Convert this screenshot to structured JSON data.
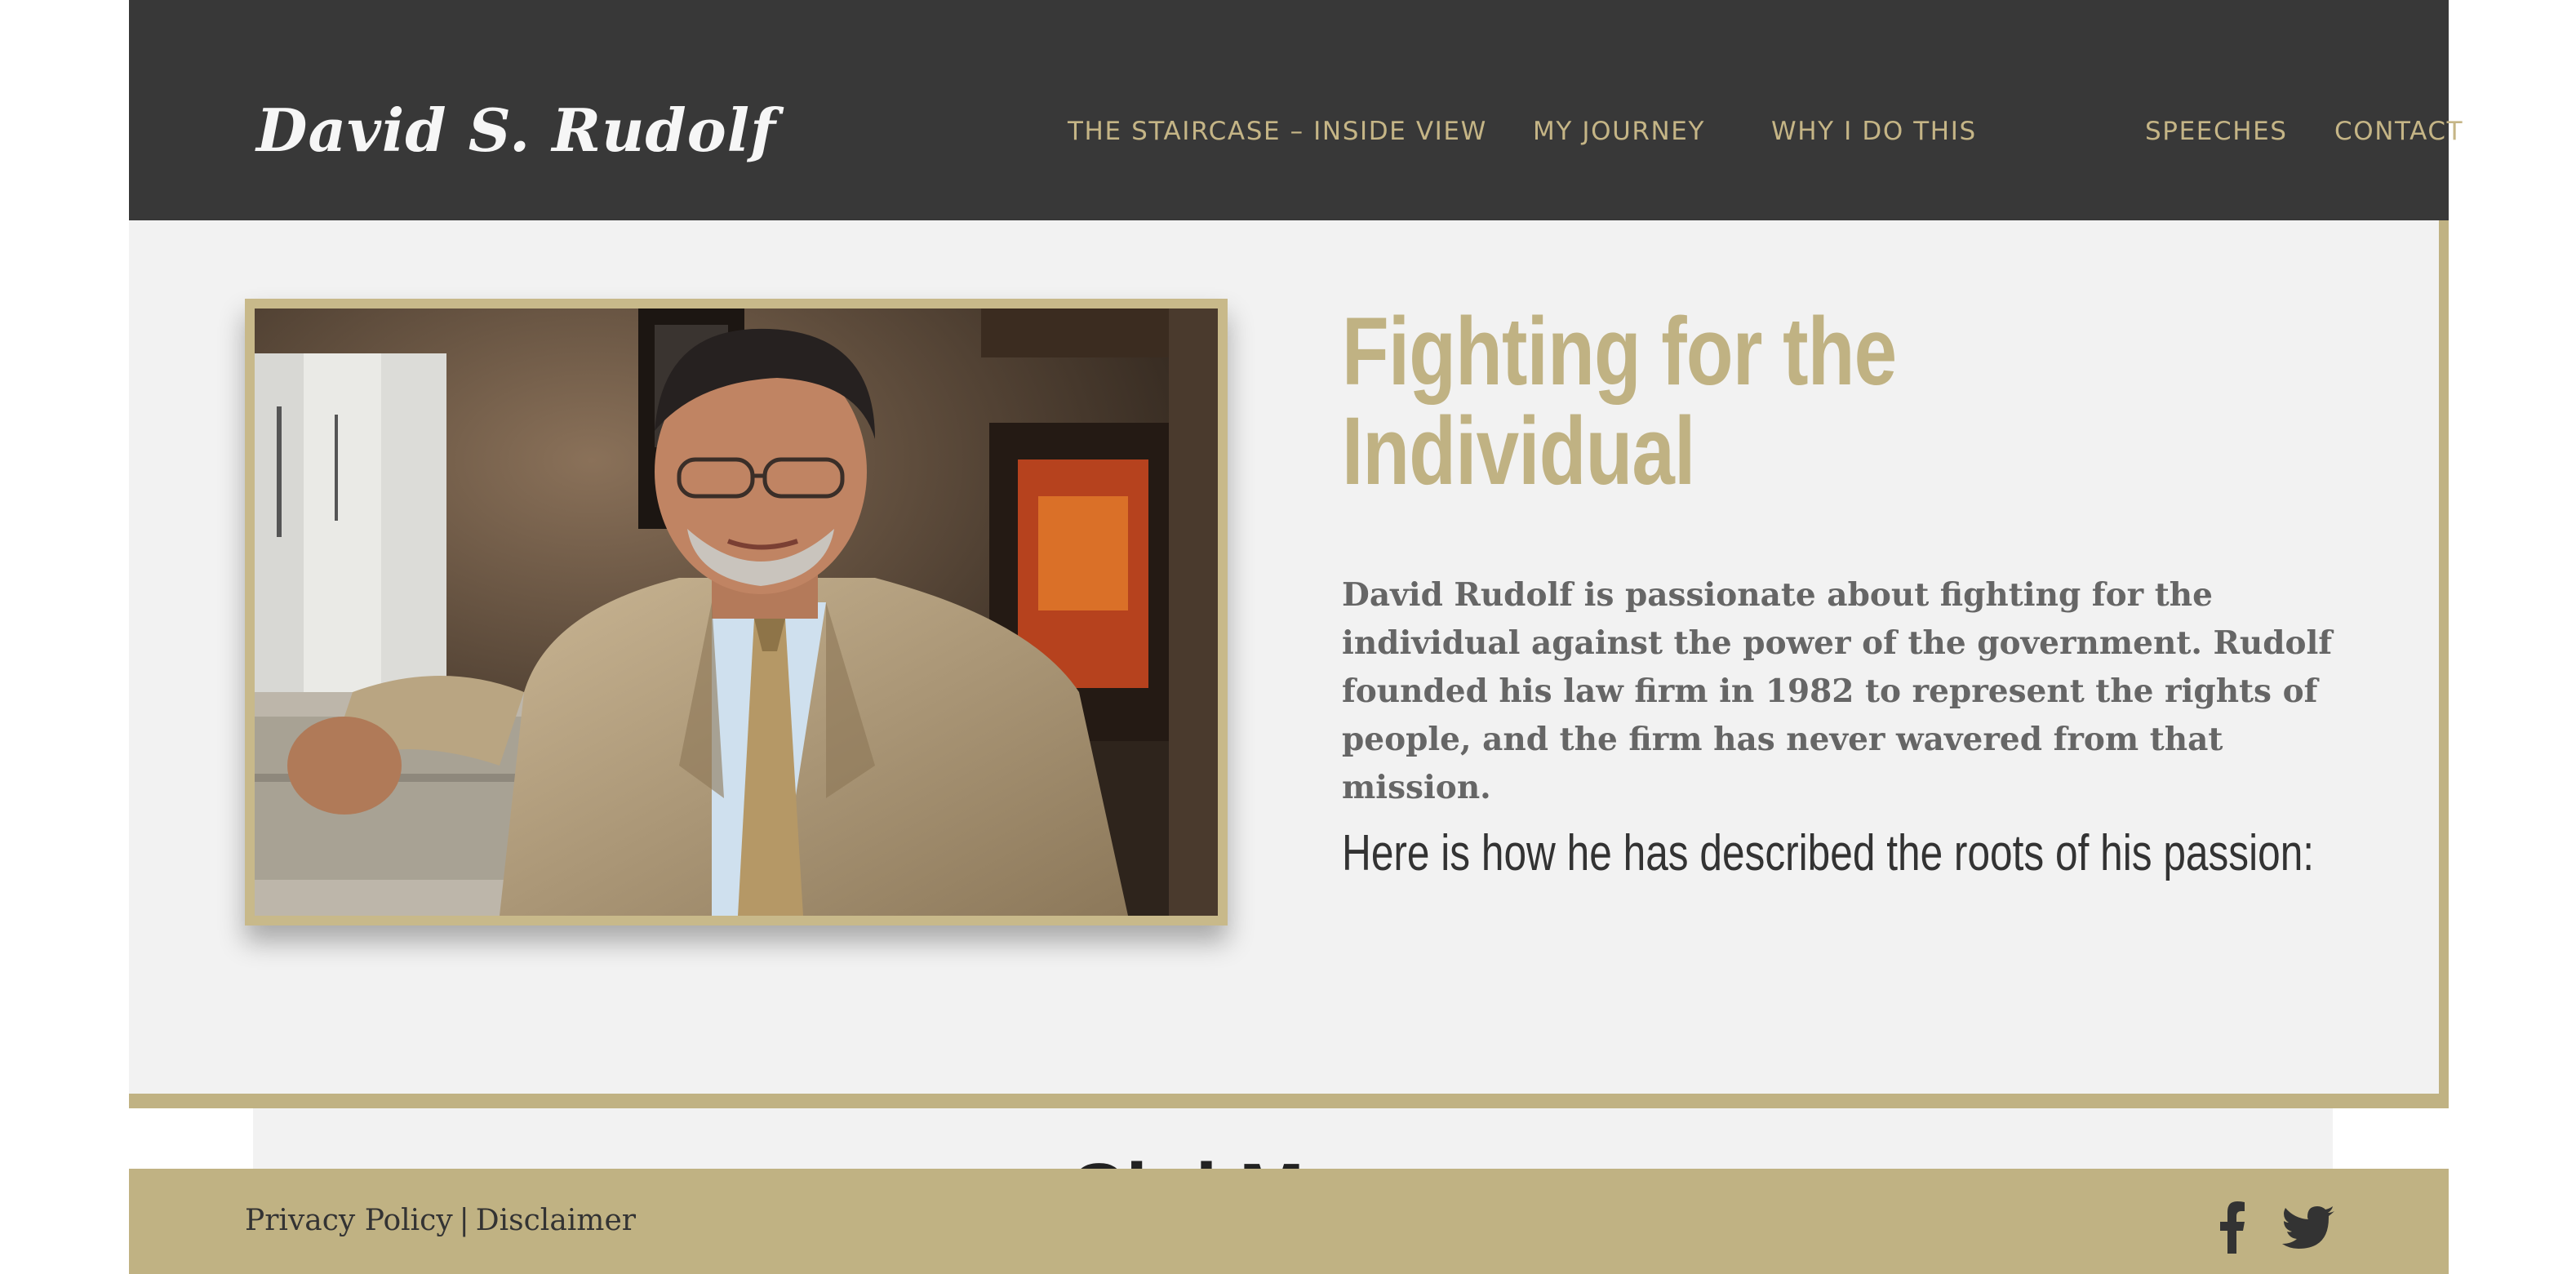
{
  "header": {
    "logo_text": "David S. Rudolf",
    "nav": [
      {
        "label": "THE STAIRCASE – INSIDE VIEW"
      },
      {
        "label": "MY JOURNEY"
      },
      {
        "label": "WHY I DO THIS"
      },
      {
        "label": "SPEECHES"
      },
      {
        "label": "CONTACT"
      }
    ]
  },
  "hero": {
    "title_line1": "Fighting for the",
    "title_line2": "Individual",
    "body": "David Rudolf is passionate about fighting for the individual against the power of the government. Rudolf founded his law firm in 1982 to represent the rights of people, and the firm has never wavered from that mission.",
    "subheading": "Here is how he has described the roots of his passion:",
    "photo_subject": "portrait of David Rudolf in office"
  },
  "next_section": {
    "heading_partial": "Cl      d M"
  },
  "footer": {
    "privacy_label": "Privacy Policy",
    "separator": "|",
    "disclaimer_label": "Disclaimer",
    "social": [
      {
        "icon": "facebook-icon"
      },
      {
        "icon": "twitter-icon"
      }
    ]
  },
  "colors": {
    "header_bg": "#383838",
    "gold_accent": "#c0b283",
    "nav_text": "#c5b586",
    "panel_bg": "#f2f2f2",
    "body_text": "#666666",
    "heading_dark": "#333333"
  }
}
